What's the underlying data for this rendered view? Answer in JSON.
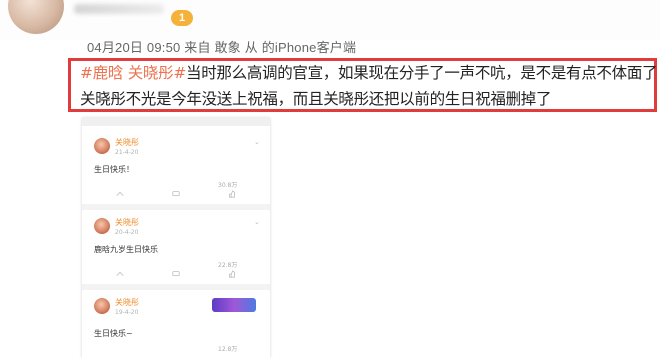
{
  "post": {
    "meta": "04月20日 09:50  来自 敢象 从 的iPhone客户端",
    "line1_tag": "#鹿晗 关晓彤#",
    "line1_rest": "当时那么高调的官宣，如果现在分手了一声不吭，是不是有点不体面了",
    "line2": "关晓彤不光是今年没送上祝福，而且关晓彤还把以前的生日祝福删掉了"
  },
  "badge": "1",
  "colors": {
    "highlight_border": "#e03c3c",
    "hashtag": "#eb7350",
    "vip_name": "#f08c2a"
  },
  "screenshot": {
    "items": [
      {
        "name": "关晓彤",
        "time": "21-4-20",
        "text": "生日快乐！",
        "likes": "30.8万",
        "action_icons": [
          "share-icon",
          "comment-icon",
          "like-icon"
        ]
      },
      {
        "name": "关晓彤",
        "time": "20-4-20",
        "text": "鹿晗九岁生日快乐",
        "likes": "22.8万",
        "action_icons": [
          "share-icon",
          "comment-icon",
          "like-icon"
        ]
      },
      {
        "name": "关晓彤",
        "time": "19-4-20",
        "text": "生日快乐~",
        "likes": "12.8万",
        "banner": "",
        "action_icons": [
          "share-icon",
          "comment-icon",
          "like-icon"
        ]
      }
    ]
  }
}
